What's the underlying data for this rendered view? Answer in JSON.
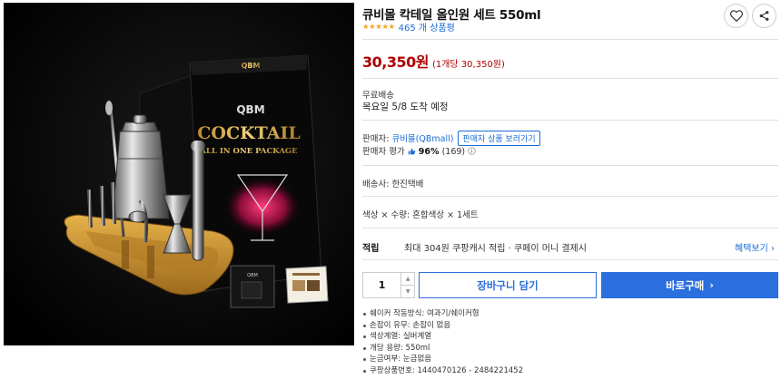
{
  "product": {
    "title": "큐비몰 칵테일 올인원 세트 550ml",
    "stars": "★★★★★",
    "review_count": "465 개 상품평",
    "price": "30,350원",
    "unit_price": "(1개당 30,350원)"
  },
  "shipping": {
    "type": "무료배송",
    "arrival": "목요일 5/8 도착 예정"
  },
  "seller": {
    "label": "판매자: ",
    "name": "큐비몰(QBmall)",
    "other_products": "판매자 상품 보러가기",
    "rating_label": "판매자 평가 ",
    "rating_percent": "96%",
    "rating_count": "(169)"
  },
  "delivery": {
    "text": "배송사: 한진택배"
  },
  "option": {
    "text": "색상 × 수량: 혼합색상 × 1세트"
  },
  "points": {
    "label": "적립",
    "text": "최대 304원 쿠팡캐시 적립 · 쿠페이 머니 결제시",
    "benefit": "혜택보기 ›"
  },
  "purchase": {
    "quantity": "1",
    "cart_label": "장바구니 담기",
    "buy_label": "바로구매",
    "buy_chevron": "›"
  },
  "specs": [
    "쉐이커 작동방식: 여과기/쉐이커형",
    "손잡이 유무: 손잡이 없음",
    "색상계열: 실버계열",
    "개당 용량: 550ml",
    "눈금여부: 눈금없음",
    "쿠팡상품번호: 1440470126 - 2484221452"
  ],
  "image": {
    "box_brand": "QBM",
    "box_title": "COCKTAIL",
    "box_subtitle": "ALL IN ONE PACKAGE",
    "pouch_label": "QBM"
  },
  "colors": {
    "price": "#ae0000",
    "link": "#1a6dd6",
    "primary": "#2b6ede",
    "star": "#f5a623"
  }
}
